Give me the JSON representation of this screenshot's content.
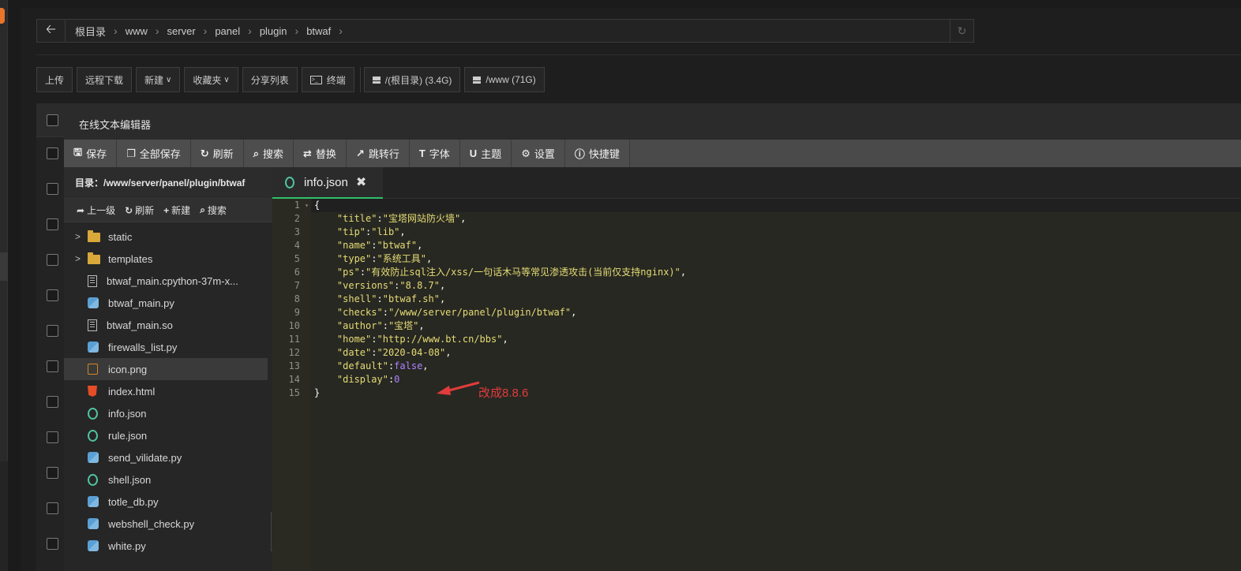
{
  "breadcrumb": [
    "根目录",
    "www",
    "server",
    "panel",
    "plugin",
    "btwaf"
  ],
  "toolbar": {
    "upload": "上传",
    "remote_download": "远程下载",
    "new": "新建",
    "favorites": "收藏夹",
    "share_list": "分享列表",
    "terminal": "终端",
    "disk_root": "/(根目录) (3.4G)",
    "disk_www": "/www (71G)"
  },
  "editor": {
    "title": "在线文本编辑器",
    "tools": {
      "save": "保存",
      "save_all": "全部保存",
      "refresh": "刷新",
      "search": "搜索",
      "replace": "替换",
      "goto_line": "跳转行",
      "font": "字体",
      "theme": "主题",
      "settings": "设置",
      "shortcuts": "快捷键"
    },
    "sidebar": {
      "dir_label": "目录：/www/server/panel/plugin/btwaf",
      "actions": {
        "up": "上一级",
        "refresh": "刷新",
        "new": "新建",
        "search": "搜索"
      },
      "files": [
        {
          "name": "static",
          "type": "folder"
        },
        {
          "name": "templates",
          "type": "folder"
        },
        {
          "name": "btwaf_main.cpython-37m-x...",
          "type": "doc"
        },
        {
          "name": "btwaf_main.py",
          "type": "py"
        },
        {
          "name": "btwaf_main.so",
          "type": "doc"
        },
        {
          "name": "firewalls_list.py",
          "type": "py"
        },
        {
          "name": "icon.png",
          "type": "png"
        },
        {
          "name": "index.html",
          "type": "html"
        },
        {
          "name": "info.json",
          "type": "json"
        },
        {
          "name": "rule.json",
          "type": "json"
        },
        {
          "name": "send_vilidate.py",
          "type": "py"
        },
        {
          "name": "shell.json",
          "type": "json"
        },
        {
          "name": "totle_db.py",
          "type": "py"
        },
        {
          "name": "webshell_check.py",
          "type": "py"
        },
        {
          "name": "white.py",
          "type": "py"
        }
      ]
    },
    "tab": {
      "name": "info.json"
    },
    "code_lines": [
      "{",
      "    \"title\":\"宝塔网站防火墙\",",
      "    \"tip\":\"lib\",",
      "    \"name\":\"btwaf\",",
      "    \"type\":\"系统工具\",",
      "    \"ps\":\"有效防止sql注入/xss/一句话木马等常见渗透攻击(当前仅支持nginx)\",",
      "    \"versions\":\"8.8.7\",",
      "    \"shell\":\"btwaf.sh\",",
      "    \"checks\":\"/www/server/panel/plugin/btwaf\",",
      "    \"author\":\"宝塔\",",
      "    \"home\":\"http://www.bt.cn/bbs\",",
      "    \"date\":\"2020-04-08\",",
      "    \"default\":false,",
      "    \"display\":0",
      "}"
    ],
    "annotation": "改成8.8.6"
  },
  "colors": {
    "annotation": "#e23b3b",
    "tab_underline": "#2fbf6a",
    "folder": "#d9a83a"
  }
}
